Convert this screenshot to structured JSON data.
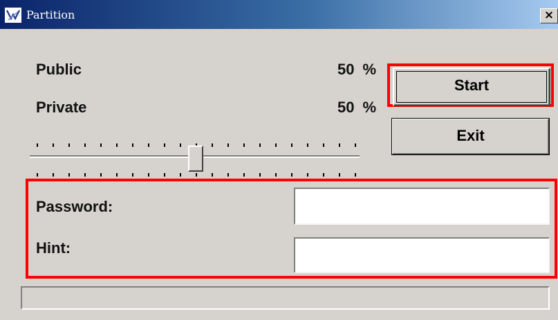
{
  "window": {
    "title": "Partition",
    "close_glyph": "×",
    "title_icon": "partition-app-icon"
  },
  "colors": {
    "titlebar_start": "#0a246a",
    "titlebar_end": "#a6caf0",
    "face": "#d6d3ce",
    "highlight": "#ff0000"
  },
  "split": {
    "public_label": "Public",
    "public_value": "50",
    "private_label": "Private",
    "private_value": "50",
    "percent_symbol": "%",
    "slider_value_percent": 50
  },
  "buttons": {
    "start_label": "Start",
    "exit_label": "Exit"
  },
  "form": {
    "password_label": "Password:",
    "password_value": "",
    "hint_label": "Hint:",
    "hint_value": ""
  },
  "status": {
    "text": ""
  }
}
